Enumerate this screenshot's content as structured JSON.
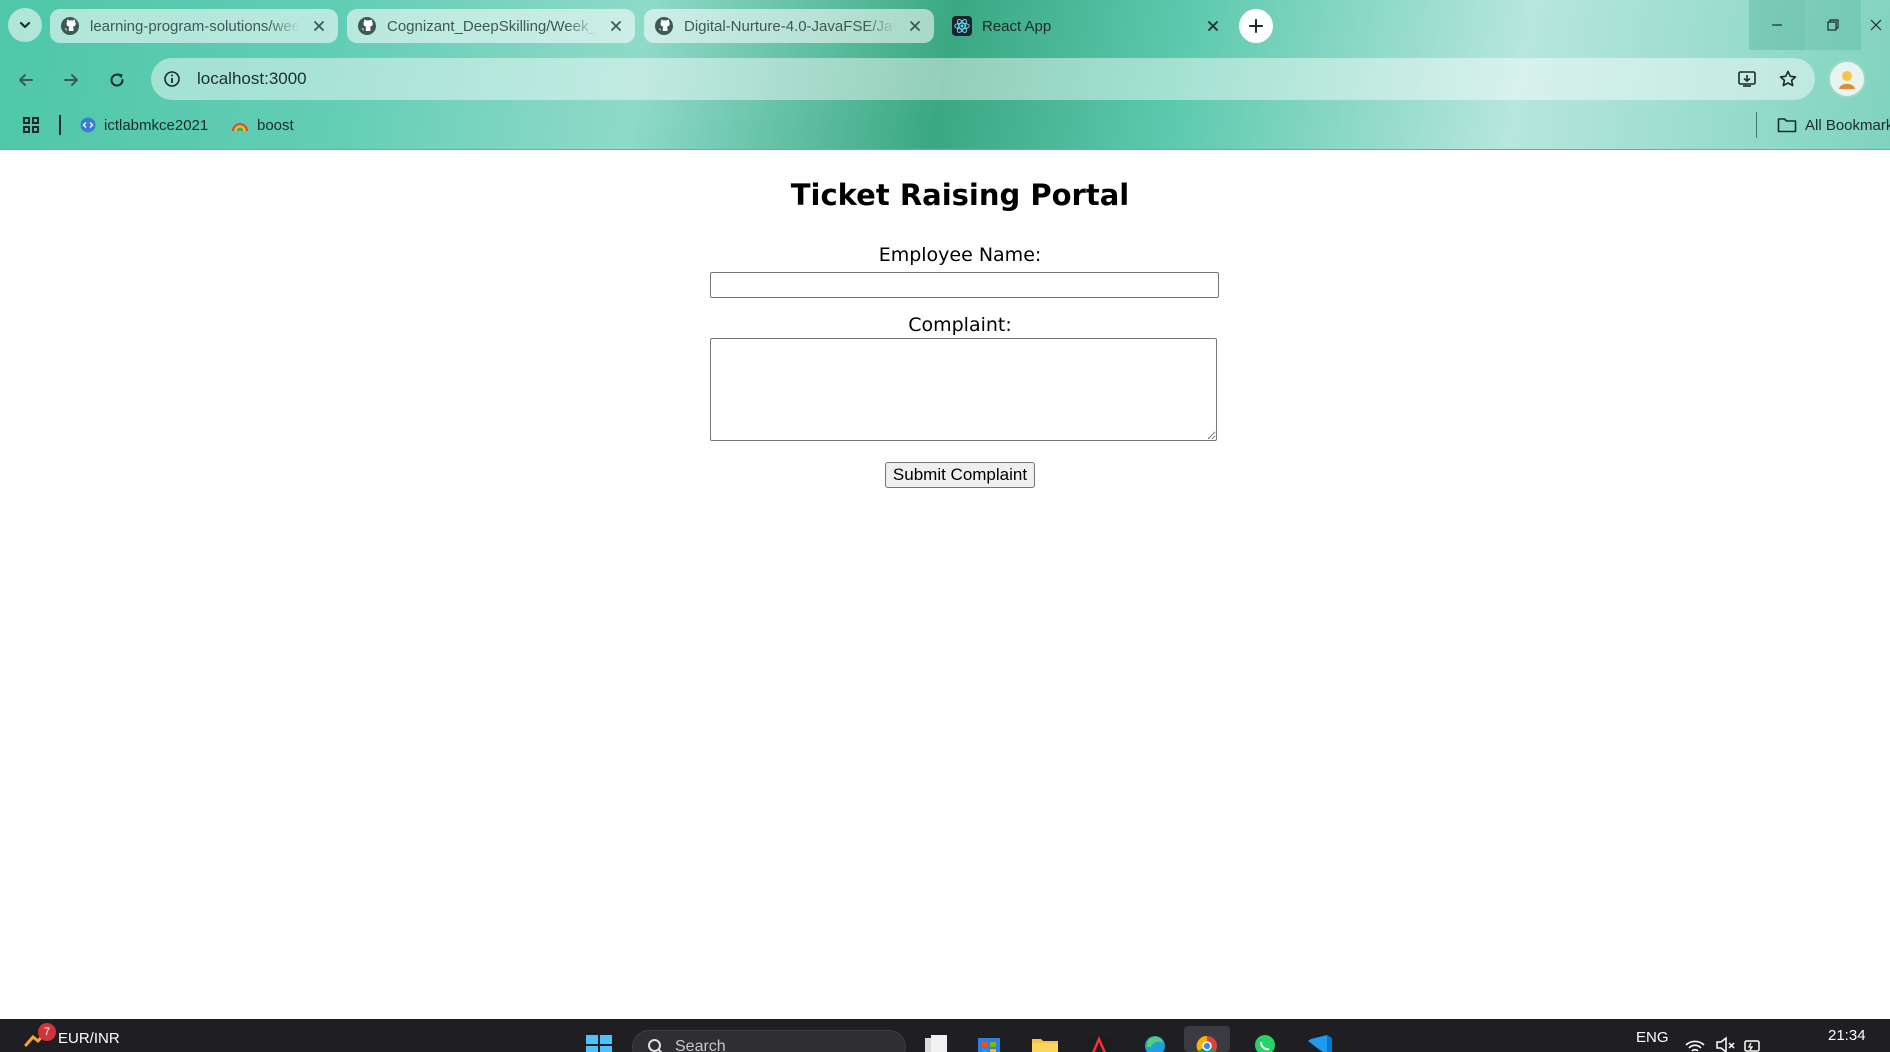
{
  "browser": {
    "tabs": [
      {
        "title": "learning-program-solutions/week",
        "favicon": "github-icon",
        "active": false
      },
      {
        "title": "Cognizant_DeepSkilling/Week_",
        "favicon": "github-icon",
        "active": false
      },
      {
        "title": "Digital-Nurture-4.0-JavaFSE/Jav",
        "favicon": "github-icon",
        "active": false
      },
      {
        "title": "React App",
        "favicon": "react-icon",
        "active": true
      }
    ],
    "url": "localhost:3000",
    "bookmarks": [
      {
        "label": "ictlabmkce2021",
        "icon": "code-icon"
      },
      {
        "label": "boost",
        "icon": "rainbow-icon"
      }
    ],
    "all_bookmarks_label": "All Bookmarks"
  },
  "page": {
    "title": "Ticket Raising Portal",
    "name_label": "Employee Name:",
    "name_value": "",
    "complaint_label": "Complaint:",
    "complaint_value": "",
    "submit_label": "Submit Complaint"
  },
  "taskbar": {
    "weather_label": "EUR/INR",
    "notification_count": "7",
    "search_placeholder": "Search",
    "language": "ENG",
    "time": "21:34"
  },
  "colors": {
    "chrome_accent": "#4fc7a8",
    "taskbar_bg": "#1f1f23",
    "badge_red": "#d13438"
  }
}
